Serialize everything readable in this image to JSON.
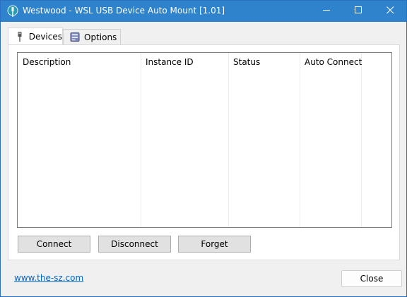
{
  "window": {
    "title": "Westwood - WSL USB Device Auto Mount [1.01]",
    "icons": {
      "app": "usb-plug-icon",
      "minimize": "minimize-icon",
      "maximize": "maximize-icon",
      "close": "close-icon"
    },
    "colors": {
      "titlebar": "#2e83cc",
      "link": "#0066cc"
    }
  },
  "tabs": [
    {
      "label": "Devices",
      "icon": "usb-plug-icon",
      "active": true
    },
    {
      "label": "Options",
      "icon": "settings-icon",
      "active": false
    }
  ],
  "device_list": {
    "columns": [
      "Description",
      "Instance ID",
      "Status",
      "Auto Connect"
    ],
    "rows": []
  },
  "actions": {
    "connect_label": "Connect",
    "disconnect_label": "Disconnect",
    "forget_label": "Forget"
  },
  "footer": {
    "link_text": "www.the-sz.com",
    "close_label": "Close"
  }
}
